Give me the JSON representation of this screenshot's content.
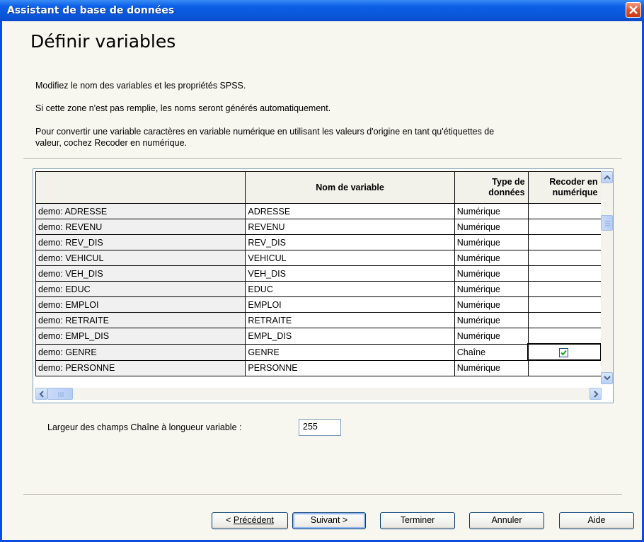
{
  "window": {
    "title": "Assistant de base de données"
  },
  "page": {
    "heading": "Définir variables",
    "desc1": "Modifiez le nom des variables et les propriétés SPSS.",
    "desc2": "Si cette zone n'est pas remplie, les noms seront générés automatiquement.",
    "desc3_line1": "Pour convertir une variable caractères en variable numérique en utilisant les valeurs d'origine en tant qu'étiquettes de",
    "desc3_line2": "valeur, cochez Recoder en numérique."
  },
  "grid": {
    "headers": {
      "source": "",
      "name": "Nom de variable",
      "type_l1": "Type de",
      "type_l2": "données",
      "recode_l1": "Recoder en",
      "recode_l2": "numérique"
    },
    "rows": [
      {
        "source": "demo: ADRESSE",
        "name": "ADRESSE",
        "type": "Numérique",
        "recode": false
      },
      {
        "source": "demo: REVENU",
        "name": "REVENU",
        "type": "Numérique",
        "recode": false
      },
      {
        "source": "demo: REV_DIS",
        "name": "REV_DIS",
        "type": "Numérique",
        "recode": false
      },
      {
        "source": "demo: VEHICUL",
        "name": "VEHICUL",
        "type": "Numérique",
        "recode": false
      },
      {
        "source": "demo: VEH_DIS",
        "name": "VEH_DIS",
        "type": "Numérique",
        "recode": false
      },
      {
        "source": "demo: EDUC",
        "name": "EDUC",
        "type": "Numérique",
        "recode": false
      },
      {
        "source": "demo: EMPLOI",
        "name": "EMPLOI",
        "type": "Numérique",
        "recode": false
      },
      {
        "source": "demo: RETRAITE",
        "name": "RETRAITE",
        "type": "Numérique",
        "recode": false
      },
      {
        "source": "demo: EMPL_DIS",
        "name": "EMPL_DIS",
        "type": "Numérique",
        "recode": false
      },
      {
        "source": "demo: GENRE",
        "name": "GENRE",
        "type": "Chaîne",
        "recode": true
      },
      {
        "source": "demo: PERSONNE",
        "name": "PERSONNE",
        "type": "Numérique",
        "recode": false
      }
    ]
  },
  "string_width": {
    "label": "Largeur des champs Chaîne à longueur variable :",
    "value": "255"
  },
  "buttons": {
    "previous": "Précédent",
    "next": "Suivant >",
    "finish": "Terminer",
    "cancel": "Annuler",
    "help": "Aide"
  }
}
